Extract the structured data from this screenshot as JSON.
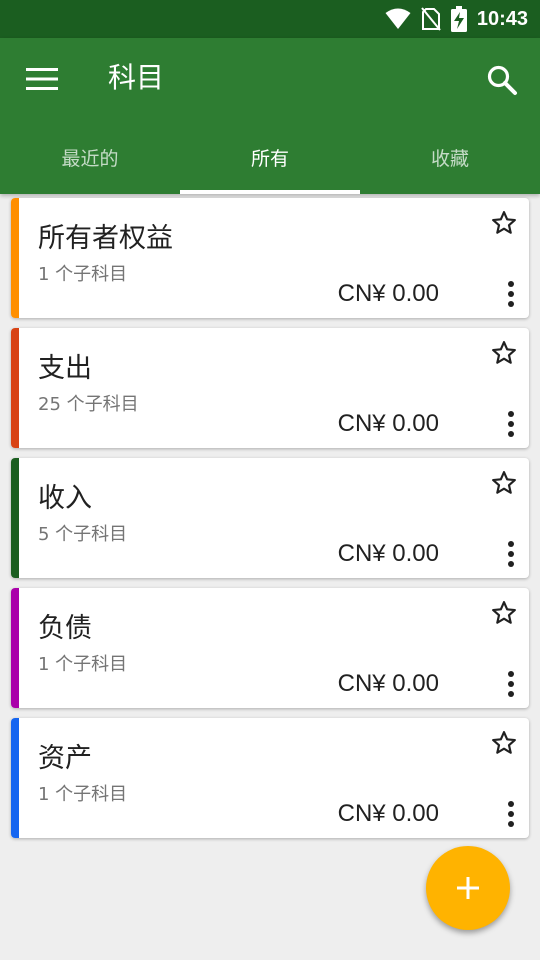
{
  "status_bar": {
    "time": "10:43",
    "icons": [
      "wifi-icon",
      "no-sim-icon",
      "battery-charging-icon"
    ]
  },
  "app_bar": {
    "title": "科目",
    "icons": {
      "menu": "menu-icon",
      "search": "search-icon"
    }
  },
  "tabs": [
    {
      "label": "最近的",
      "active": false
    },
    {
      "label": "所有",
      "active": true
    },
    {
      "label": "收藏",
      "active": false
    }
  ],
  "accounts": [
    {
      "name": "所有者权益",
      "children": "1 个子科目",
      "balance": "CN¥ 0.00",
      "color": "#ff8f00"
    },
    {
      "name": "支出",
      "children": "25 个子科目",
      "balance": "CN¥ 0.00",
      "color": "#d84315"
    },
    {
      "name": "收入",
      "children": "5 个子科目",
      "balance": "CN¥ 0.00",
      "color": "#1b5e20"
    },
    {
      "name": "负债",
      "children": "1 个子科目",
      "balance": "CN¥ 0.00",
      "color": "#aa00aa"
    },
    {
      "name": "资产",
      "children": "1 个子科目",
      "balance": "CN¥ 0.00",
      "color": "#1565f0"
    }
  ],
  "colors": {
    "status_bar": "#1b5e20",
    "app_bar": "#2e7d32",
    "fab": "#ffb300"
  },
  "fab": {
    "icon": "plus-icon"
  }
}
